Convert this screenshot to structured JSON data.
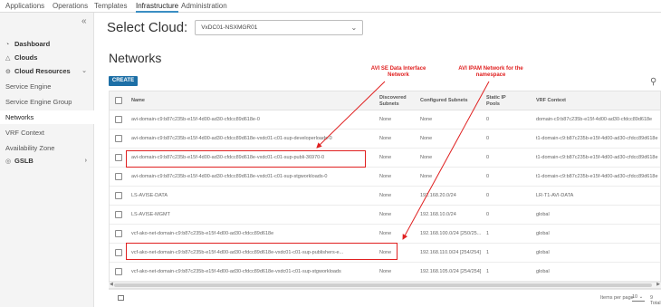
{
  "topnav": {
    "tabs": [
      {
        "label": "Applications"
      },
      {
        "label": "Operations"
      },
      {
        "label": "Templates"
      },
      {
        "label": "Infrastructure"
      },
      {
        "label": "Administration"
      }
    ]
  },
  "sidebar": {
    "collapse_glyph": "«",
    "items": [
      {
        "label": "Dashboard",
        "icon": "dashboard-icon"
      },
      {
        "label": "Clouds",
        "icon": "cloud-icon"
      },
      {
        "label": "Cloud Resources",
        "icon": "cloud-resources-icon"
      },
      {
        "label": "Service Engine"
      },
      {
        "label": "Service Engine Group"
      },
      {
        "label": "Networks"
      },
      {
        "label": "VRF Context"
      },
      {
        "label": "Availability Zone"
      },
      {
        "label": "GSLB",
        "icon": "globe-icon"
      }
    ]
  },
  "cloud_select": {
    "label": "Select Cloud:",
    "value": "VxDC01-NSXMGR01"
  },
  "page": {
    "title": "Networks",
    "create_label": "CREATE"
  },
  "table": {
    "columns": [
      "Name",
      "Discovered Subnets",
      "Configured Subnets",
      "Static IP Pools",
      "VRF Context"
    ],
    "rows": [
      [
        "avi-domain-c9:b87c235b-e15f-4d00-ad30-cfdcc89d618e-0",
        "None",
        "None",
        "0",
        "domain-c9:b87c235b-e15f-4d00-ad30-cfdcc89d618e"
      ],
      [
        "avi-domain-c9:b87c235b-e15f-4d00-ad30-cfdcc89d618e-vxdc01-c01-sup-developerloads-0",
        "None",
        "None",
        "0",
        "t1-domain-c9:b87c235b-e15f-4d00-ad30-cfdcc89d618e"
      ],
      [
        "avi-domain-c9:b87c235b-e15f-4d00-ad30-cfdcc89d618e-vxdc01-c01-sup-publi-36970-0",
        "None",
        "None",
        "0",
        "t1-domain-c9:b87c235b-e15f-4d00-ad30-cfdcc89d618e"
      ],
      [
        "avi-domain-c9:b87c235b-e15f-4d00-ad30-cfdcc89d618e-vxdc01-c01-sup-stgworkloads-0",
        "None",
        "None",
        "0",
        "t1-domain-c9:b87c235b-e15f-4d00-ad30-cfdcc89d618e"
      ],
      [
        "LS-AVISE-DATA",
        "None",
        "192.168.20.0/24",
        "0",
        "LR-T1-AVI-DATA"
      ],
      [
        "LS-AVISE-MGMT",
        "None",
        "192.168.10.0/24",
        "0",
        "global"
      ],
      [
        "vcf-ako-net-domain-c9:b87c235b-e15f-4d00-ad30-cfdcc89d618e",
        "None",
        "192.168.100.0/24 [250/25...",
        "1",
        "global"
      ],
      [
        "vcf-ako-net-domain-c9:b87c235b-e15f-4d00-ad30-cfdcc89d618e-vxdc01-c01-sup-publishers-e...",
        "None",
        "192.168.110.0/24 [254/254]",
        "1",
        "global"
      ],
      [
        "vcf-ako-net-domain-c9:b87c235b-e15f-4d00-ad30-cfdcc89d618e-vxdc01-c01-sup-stgworkloads",
        "None",
        "192.168.105.0/24 [254/254]",
        "1",
        "global"
      ]
    ]
  },
  "footer": {
    "items_per_page_label": "Items per page",
    "items_per_page_value": "10",
    "total": "9 Total"
  },
  "annotations": [
    {
      "text": "AVI SE Data Interface Network"
    },
    {
      "text": "AVI IPAM Network for the namespace"
    }
  ],
  "colors": {
    "accent": "#1d6fa6",
    "annotation": "#e02020",
    "sidebar_bg": "#f4f4f4"
  }
}
